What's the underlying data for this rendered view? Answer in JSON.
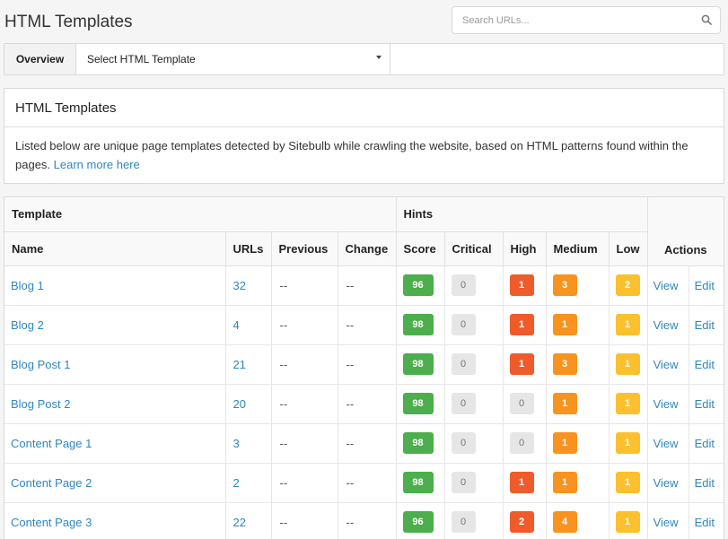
{
  "page": {
    "title": "HTML Templates"
  },
  "search": {
    "placeholder": "Search URLs..."
  },
  "toolbar": {
    "overview_label": "Overview",
    "select_label": "Select HTML Template"
  },
  "info": {
    "title": "HTML Templates",
    "description": "Listed below are unique page templates detected by Sitebulb while crawling the website, based on HTML patterns found within the pages. ",
    "link_text": "Learn more here"
  },
  "table": {
    "group_headers": {
      "template": "Template",
      "hints": "Hints",
      "actions": "Actions"
    },
    "columns": [
      "Name",
      "URLs",
      "Previous",
      "Change",
      "Score",
      "Critical",
      "High",
      "Medium",
      "Low"
    ],
    "action_labels": {
      "view": "View",
      "edit": "Edit"
    },
    "rows": [
      {
        "name": "Blog 1",
        "urls": "32",
        "previous": "--",
        "change": "--",
        "score": "96",
        "critical": "0",
        "high": "1",
        "medium": "3",
        "low": "2"
      },
      {
        "name": "Blog 2",
        "urls": "4",
        "previous": "--",
        "change": "--",
        "score": "98",
        "critical": "0",
        "high": "1",
        "medium": "1",
        "low": "1"
      },
      {
        "name": "Blog Post 1",
        "urls": "21",
        "previous": "--",
        "change": "--",
        "score": "98",
        "critical": "0",
        "high": "1",
        "medium": "3",
        "low": "1"
      },
      {
        "name": "Blog Post 2",
        "urls": "20",
        "previous": "--",
        "change": "--",
        "score": "98",
        "critical": "0",
        "high": "0",
        "medium": "1",
        "low": "1"
      },
      {
        "name": "Content Page 1",
        "urls": "3",
        "previous": "--",
        "change": "--",
        "score": "98",
        "critical": "0",
        "high": "0",
        "medium": "1",
        "low": "1"
      },
      {
        "name": "Content Page 2",
        "urls": "2",
        "previous": "--",
        "change": "--",
        "score": "98",
        "critical": "0",
        "high": "1",
        "medium": "1",
        "low": "1"
      },
      {
        "name": "Content Page 3",
        "urls": "22",
        "previous": "--",
        "change": "--",
        "score": "96",
        "critical": "0",
        "high": "2",
        "medium": "4",
        "low": "1"
      }
    ]
  },
  "colors": {
    "score": "#4cae4c",
    "critical": "#e6e6e6",
    "high_active": "#f05b2b",
    "high_zero": "#e6e6e6",
    "medium": "#f7931e",
    "low": "#fbc02d",
    "link": "#2d87c2"
  }
}
